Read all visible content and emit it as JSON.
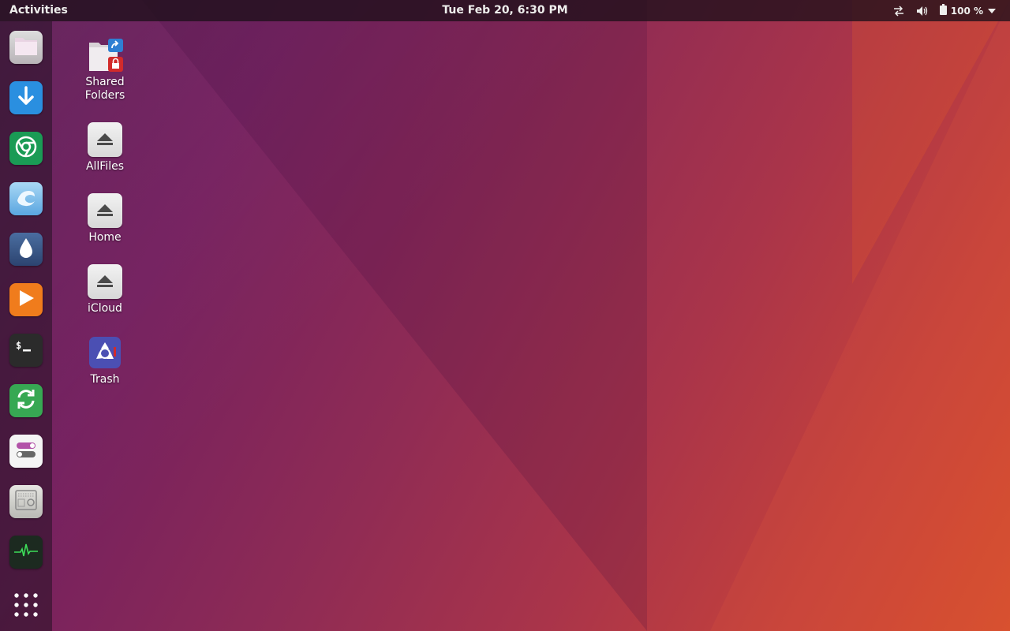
{
  "topbar": {
    "activities_label": "Activities",
    "clock": "Tue Feb 20,  6:30 PM",
    "battery_percent": "100 %",
    "icons": [
      "network-icon",
      "volume-icon",
      "battery-icon",
      "menu-arrow-icon"
    ]
  },
  "dock": {
    "items": [
      {
        "name": "files",
        "icon": "folder-icon"
      },
      {
        "name": "downloader",
        "icon": "download-arrow-icon"
      },
      {
        "name": "chrome",
        "icon": "chrome-icon"
      },
      {
        "name": "browser-wave",
        "icon": "wave-icon"
      },
      {
        "name": "drop",
        "icon": "water-drop-icon"
      },
      {
        "name": "media-player",
        "icon": "play-icon"
      },
      {
        "name": "terminal",
        "icon": "terminal-icon"
      },
      {
        "name": "sync",
        "icon": "sync-icon"
      },
      {
        "name": "settings",
        "icon": "toggle-switches-icon"
      },
      {
        "name": "radio",
        "icon": "radio-icon"
      },
      {
        "name": "system-monitor",
        "icon": "heartbeat-icon"
      }
    ],
    "show_apps_icon": "app-grid-icon"
  },
  "desktop": {
    "icons": [
      {
        "label_lines": [
          "Shared",
          "Folders"
        ],
        "icon": "shared-folder-icon"
      },
      {
        "label_lines": [
          "AllFiles"
        ],
        "icon": "eject-drive-icon"
      },
      {
        "label_lines": [
          "Home"
        ],
        "icon": "eject-drive-icon"
      },
      {
        "label_lines": [
          "iCloud"
        ],
        "icon": "eject-drive-icon"
      },
      {
        "label_lines": [
          "Trash"
        ],
        "icon": "trash-icon"
      }
    ]
  },
  "colors": {
    "topbar_bg": "#1d101a",
    "wallpaper_left": "#5c1a55",
    "wallpaper_right": "#d44d2e",
    "chrome_green": "#1a9b55",
    "download_blue": "#2a8fe0",
    "play_orange": "#f07c1c",
    "sync_green": "#37a853"
  }
}
